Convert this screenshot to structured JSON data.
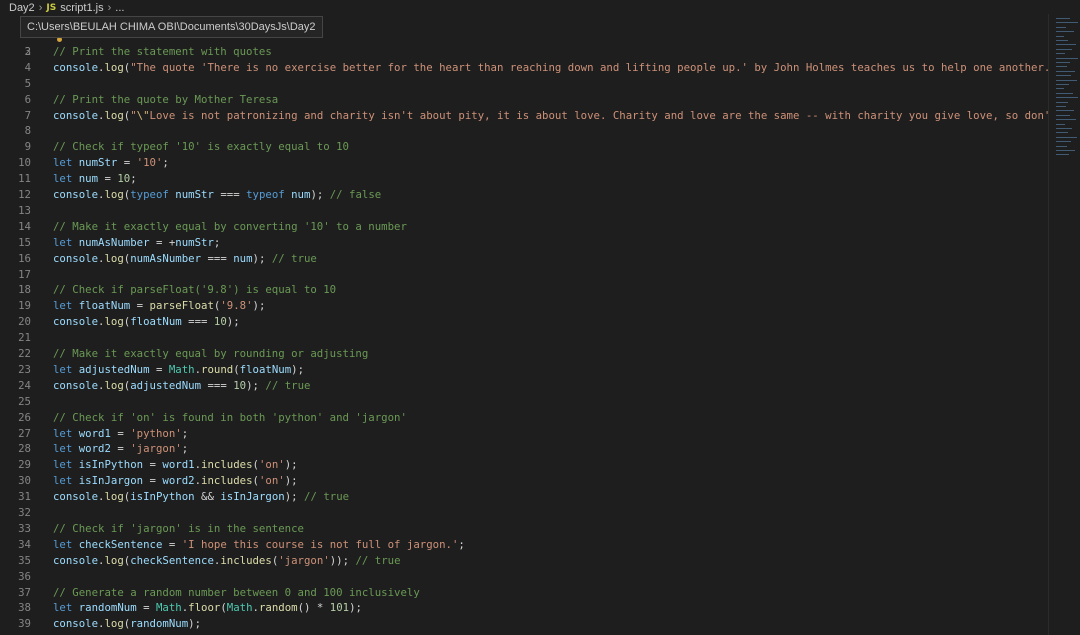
{
  "breadcrumb": {
    "folder": "Day2",
    "file_icon": "JS",
    "file": "script1.js",
    "ellipsis": "..."
  },
  "tooltip": {
    "path": "C:\\Users\\BEULAH CHIMA OBI\\Documents\\30DaysJs\\Day2"
  },
  "partial_line_number": "2",
  "lines": [
    {
      "n": "3",
      "tokens": [
        {
          "t": "// Print the statement with quotes",
          "c": "comment"
        }
      ]
    },
    {
      "n": "4",
      "tokens": [
        {
          "t": "console",
          "c": "var"
        },
        {
          "t": ".",
          "c": "punct"
        },
        {
          "t": "log",
          "c": "fn"
        },
        {
          "t": "(",
          "c": "punct"
        },
        {
          "t": "\"The quote 'There is no exercise better for the heart than reaching down and lifting people up.' by John Holmes teaches us to help one another.\"",
          "c": "string"
        }
      ]
    },
    {
      "n": "5",
      "tokens": []
    },
    {
      "n": "6",
      "tokens": [
        {
          "t": "// Print the quote by Mother Teresa",
          "c": "comment"
        }
      ]
    },
    {
      "n": "7",
      "tokens": [
        {
          "t": "console",
          "c": "var"
        },
        {
          "t": ".",
          "c": "punct"
        },
        {
          "t": "log",
          "c": "fn"
        },
        {
          "t": "(",
          "c": "punct"
        },
        {
          "t": "\"",
          "c": "string"
        },
        {
          "t": "\\\"",
          "c": "escape"
        },
        {
          "t": "Love is not patronizing and charity isn't about pity, it is about love. Charity and love are the same -- with charity you give love, so don't",
          "c": "string"
        }
      ]
    },
    {
      "n": "8",
      "tokens": []
    },
    {
      "n": "9",
      "tokens": [
        {
          "t": "// Check if typeof '10' is exactly equal to 10",
          "c": "comment"
        }
      ]
    },
    {
      "n": "10",
      "tokens": [
        {
          "t": "let",
          "c": "keyword"
        },
        {
          "t": " ",
          "c": "punct"
        },
        {
          "t": "numStr",
          "c": "var"
        },
        {
          "t": " = ",
          "c": "op"
        },
        {
          "t": "'10'",
          "c": "string"
        },
        {
          "t": ";",
          "c": "punct"
        }
      ]
    },
    {
      "n": "11",
      "tokens": [
        {
          "t": "let",
          "c": "keyword"
        },
        {
          "t": " ",
          "c": "punct"
        },
        {
          "t": "num",
          "c": "var"
        },
        {
          "t": " = ",
          "c": "op"
        },
        {
          "t": "10",
          "c": "number"
        },
        {
          "t": ";",
          "c": "punct"
        }
      ]
    },
    {
      "n": "12",
      "tokens": [
        {
          "t": "console",
          "c": "var"
        },
        {
          "t": ".",
          "c": "punct"
        },
        {
          "t": "log",
          "c": "fn"
        },
        {
          "t": "(",
          "c": "punct"
        },
        {
          "t": "typeof",
          "c": "keyword"
        },
        {
          "t": " ",
          "c": "punct"
        },
        {
          "t": "numStr",
          "c": "var"
        },
        {
          "t": " === ",
          "c": "op"
        },
        {
          "t": "typeof",
          "c": "keyword"
        },
        {
          "t": " ",
          "c": "punct"
        },
        {
          "t": "num",
          "c": "var"
        },
        {
          "t": "); ",
          "c": "punct"
        },
        {
          "t": "// false",
          "c": "comment"
        }
      ]
    },
    {
      "n": "13",
      "tokens": []
    },
    {
      "n": "14",
      "tokens": [
        {
          "t": "// Make it exactly equal by converting '10' to a number",
          "c": "comment"
        }
      ]
    },
    {
      "n": "15",
      "tokens": [
        {
          "t": "let",
          "c": "keyword"
        },
        {
          "t": " ",
          "c": "punct"
        },
        {
          "t": "numAsNumber",
          "c": "var"
        },
        {
          "t": " = +",
          "c": "op"
        },
        {
          "t": "numStr",
          "c": "var"
        },
        {
          "t": ";",
          "c": "punct"
        }
      ]
    },
    {
      "n": "16",
      "tokens": [
        {
          "t": "console",
          "c": "var"
        },
        {
          "t": ".",
          "c": "punct"
        },
        {
          "t": "log",
          "c": "fn"
        },
        {
          "t": "(",
          "c": "punct"
        },
        {
          "t": "numAsNumber",
          "c": "var"
        },
        {
          "t": " === ",
          "c": "op"
        },
        {
          "t": "num",
          "c": "var"
        },
        {
          "t": "); ",
          "c": "punct"
        },
        {
          "t": "// true",
          "c": "comment"
        }
      ]
    },
    {
      "n": "17",
      "tokens": []
    },
    {
      "n": "18",
      "tokens": [
        {
          "t": "// Check if parseFloat('9.8') is equal to 10",
          "c": "comment"
        }
      ]
    },
    {
      "n": "19",
      "tokens": [
        {
          "t": "let",
          "c": "keyword"
        },
        {
          "t": " ",
          "c": "punct"
        },
        {
          "t": "floatNum",
          "c": "var"
        },
        {
          "t": " = ",
          "c": "op"
        },
        {
          "t": "parseFloat",
          "c": "fn"
        },
        {
          "t": "(",
          "c": "punct"
        },
        {
          "t": "'9.8'",
          "c": "string"
        },
        {
          "t": ");",
          "c": "punct"
        }
      ]
    },
    {
      "n": "20",
      "tokens": [
        {
          "t": "console",
          "c": "var"
        },
        {
          "t": ".",
          "c": "punct"
        },
        {
          "t": "log",
          "c": "fn"
        },
        {
          "t": "(",
          "c": "punct"
        },
        {
          "t": "floatNum",
          "c": "var"
        },
        {
          "t": " === ",
          "c": "op"
        },
        {
          "t": "10",
          "c": "number"
        },
        {
          "t": ");",
          "c": "punct"
        }
      ]
    },
    {
      "n": "21",
      "tokens": []
    },
    {
      "n": "22",
      "tokens": [
        {
          "t": "// Make it exactly equal by rounding or adjusting",
          "c": "comment"
        }
      ]
    },
    {
      "n": "23",
      "tokens": [
        {
          "t": "let",
          "c": "keyword"
        },
        {
          "t": " ",
          "c": "punct"
        },
        {
          "t": "adjustedNum",
          "c": "var"
        },
        {
          "t": " = ",
          "c": "op"
        },
        {
          "t": "Math",
          "c": "obj"
        },
        {
          "t": ".",
          "c": "punct"
        },
        {
          "t": "round",
          "c": "fn"
        },
        {
          "t": "(",
          "c": "punct"
        },
        {
          "t": "floatNum",
          "c": "var"
        },
        {
          "t": ");",
          "c": "punct"
        }
      ]
    },
    {
      "n": "24",
      "tokens": [
        {
          "t": "console",
          "c": "var"
        },
        {
          "t": ".",
          "c": "punct"
        },
        {
          "t": "log",
          "c": "fn"
        },
        {
          "t": "(",
          "c": "punct"
        },
        {
          "t": "adjustedNum",
          "c": "var"
        },
        {
          "t": " === ",
          "c": "op"
        },
        {
          "t": "10",
          "c": "number"
        },
        {
          "t": "); ",
          "c": "punct"
        },
        {
          "t": "// true",
          "c": "comment"
        }
      ]
    },
    {
      "n": "25",
      "tokens": []
    },
    {
      "n": "26",
      "tokens": [
        {
          "t": "// Check if 'on' is found in both 'python' and 'jargon'",
          "c": "comment"
        }
      ]
    },
    {
      "n": "27",
      "tokens": [
        {
          "t": "let",
          "c": "keyword"
        },
        {
          "t": " ",
          "c": "punct"
        },
        {
          "t": "word1",
          "c": "var"
        },
        {
          "t": " = ",
          "c": "op"
        },
        {
          "t": "'python'",
          "c": "string"
        },
        {
          "t": ";",
          "c": "punct"
        }
      ]
    },
    {
      "n": "28",
      "tokens": [
        {
          "t": "let",
          "c": "keyword"
        },
        {
          "t": " ",
          "c": "punct"
        },
        {
          "t": "word2",
          "c": "var"
        },
        {
          "t": " = ",
          "c": "op"
        },
        {
          "t": "'jargon'",
          "c": "string"
        },
        {
          "t": ";",
          "c": "punct"
        }
      ]
    },
    {
      "n": "29",
      "tokens": [
        {
          "t": "let",
          "c": "keyword"
        },
        {
          "t": " ",
          "c": "punct"
        },
        {
          "t": "isInPython",
          "c": "var"
        },
        {
          "t": " = ",
          "c": "op"
        },
        {
          "t": "word1",
          "c": "var"
        },
        {
          "t": ".",
          "c": "punct"
        },
        {
          "t": "includes",
          "c": "fn"
        },
        {
          "t": "(",
          "c": "punct"
        },
        {
          "t": "'on'",
          "c": "string"
        },
        {
          "t": ");",
          "c": "punct"
        }
      ]
    },
    {
      "n": "30",
      "tokens": [
        {
          "t": "let",
          "c": "keyword"
        },
        {
          "t": " ",
          "c": "punct"
        },
        {
          "t": "isInJargon",
          "c": "var"
        },
        {
          "t": " = ",
          "c": "op"
        },
        {
          "t": "word2",
          "c": "var"
        },
        {
          "t": ".",
          "c": "punct"
        },
        {
          "t": "includes",
          "c": "fn"
        },
        {
          "t": "(",
          "c": "punct"
        },
        {
          "t": "'on'",
          "c": "string"
        },
        {
          "t": ");",
          "c": "punct"
        }
      ]
    },
    {
      "n": "31",
      "tokens": [
        {
          "t": "console",
          "c": "var"
        },
        {
          "t": ".",
          "c": "punct"
        },
        {
          "t": "log",
          "c": "fn"
        },
        {
          "t": "(",
          "c": "punct"
        },
        {
          "t": "isInPython",
          "c": "var"
        },
        {
          "t": " && ",
          "c": "op"
        },
        {
          "t": "isInJargon",
          "c": "var"
        },
        {
          "t": "); ",
          "c": "punct"
        },
        {
          "t": "// true",
          "c": "comment"
        }
      ]
    },
    {
      "n": "32",
      "tokens": []
    },
    {
      "n": "33",
      "tokens": [
        {
          "t": "// Check if 'jargon' is in the sentence",
          "c": "comment"
        }
      ]
    },
    {
      "n": "34",
      "tokens": [
        {
          "t": "let",
          "c": "keyword"
        },
        {
          "t": " ",
          "c": "punct"
        },
        {
          "t": "checkSentence",
          "c": "var"
        },
        {
          "t": " = ",
          "c": "op"
        },
        {
          "t": "'I hope this course is not full of jargon.'",
          "c": "string"
        },
        {
          "t": ";",
          "c": "punct"
        }
      ]
    },
    {
      "n": "35",
      "tokens": [
        {
          "t": "console",
          "c": "var"
        },
        {
          "t": ".",
          "c": "punct"
        },
        {
          "t": "log",
          "c": "fn"
        },
        {
          "t": "(",
          "c": "punct"
        },
        {
          "t": "checkSentence",
          "c": "var"
        },
        {
          "t": ".",
          "c": "punct"
        },
        {
          "t": "includes",
          "c": "fn"
        },
        {
          "t": "(",
          "c": "punct"
        },
        {
          "t": "'jargon'",
          "c": "string"
        },
        {
          "t": ")); ",
          "c": "punct"
        },
        {
          "t": "// true",
          "c": "comment"
        }
      ]
    },
    {
      "n": "36",
      "tokens": []
    },
    {
      "n": "37",
      "tokens": [
        {
          "t": "// Generate a random number between 0 and 100 inclusively",
          "c": "comment"
        }
      ]
    },
    {
      "n": "38",
      "tokens": [
        {
          "t": "let",
          "c": "keyword"
        },
        {
          "t": " ",
          "c": "punct"
        },
        {
          "t": "randomNum",
          "c": "var"
        },
        {
          "t": " = ",
          "c": "op"
        },
        {
          "t": "Math",
          "c": "obj"
        },
        {
          "t": ".",
          "c": "punct"
        },
        {
          "t": "floor",
          "c": "fn"
        },
        {
          "t": "(",
          "c": "punct"
        },
        {
          "t": "Math",
          "c": "obj"
        },
        {
          "t": ".",
          "c": "punct"
        },
        {
          "t": "random",
          "c": "fn"
        },
        {
          "t": "() * ",
          "c": "punct"
        },
        {
          "t": "101",
          "c": "number"
        },
        {
          "t": ");",
          "c": "punct"
        }
      ]
    },
    {
      "n": "39",
      "tokens": [
        {
          "t": "console",
          "c": "var"
        },
        {
          "t": ".",
          "c": "punct"
        },
        {
          "t": "log",
          "c": "fn"
        },
        {
          "t": "(",
          "c": "punct"
        },
        {
          "t": "randomNum",
          "c": "var"
        },
        {
          "t": ");",
          "c": "punct"
        }
      ]
    }
  ]
}
